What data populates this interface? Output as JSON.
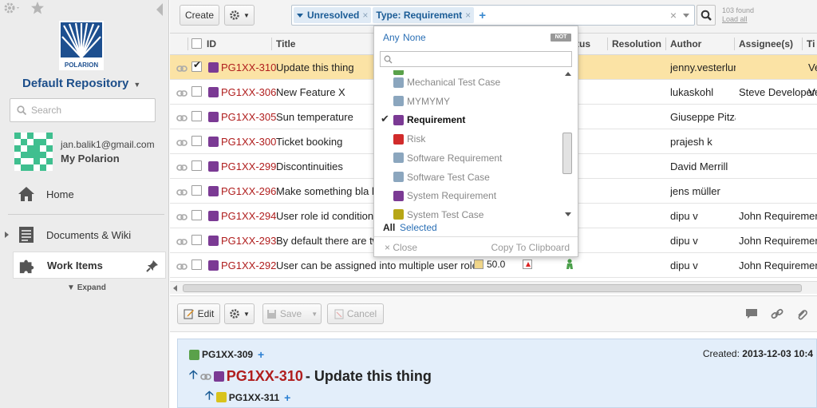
{
  "sidebar": {
    "logo_text": "POLARION",
    "repository": "Default Repository",
    "search_placeholder": "Search",
    "user_email": "jan.balik1@gmail.com",
    "my_polarion": "My Polarion",
    "nav": {
      "home": "Home",
      "docs": "Documents & Wiki",
      "work_items": "Work Items",
      "expand": "Expand"
    }
  },
  "toolbar": {
    "create": "Create",
    "query_chips": [
      "Unresolved",
      "Type: Requirement"
    ],
    "found": "103 found",
    "load_all": "Load all"
  },
  "table": {
    "columns": [
      "ID",
      "Title",
      "Status",
      "Resolution",
      "Author",
      "Assignee(s)",
      "Ti"
    ],
    "rows": [
      {
        "id": "PG1XX-310",
        "title": "Update this thing",
        "author": "jenny.vesterlund",
        "assignee": "",
        "extra": "Ve",
        "selected": true
      },
      {
        "id": "PG1XX-306",
        "title": "New Feature X",
        "author": "lukaskohl",
        "assignee": "Steve Developer",
        "extra": "Ve",
        "selected": false
      },
      {
        "id": "PG1XX-305",
        "title": "Sun temperature",
        "author": "Giuseppe Pitzalis",
        "assignee": "",
        "extra": "",
        "selected": false
      },
      {
        "id": "PG1XX-300",
        "title": "Ticket booking",
        "author": "prajesh k",
        "assignee": "",
        "extra": "",
        "selected": false
      },
      {
        "id": "PG1XX-299",
        "title": "Discontinuities",
        "author": "David Merrill",
        "assignee": "",
        "extra": "",
        "selected": false
      },
      {
        "id": "PG1XX-296",
        "title": "Make something bla bla",
        "author": "jens müller",
        "assignee": "",
        "extra": "",
        "selected": false
      },
      {
        "id": "PG1XX-294",
        "title": "User role id conditions",
        "author": "dipu v",
        "assignee": "John Requirements",
        "extra": "",
        "selected": false
      },
      {
        "id": "PG1XX-293",
        "title": "By default there are two",
        "author": "dipu v",
        "assignee": "John Requirements",
        "extra": "",
        "selected": false
      },
      {
        "id": "PG1XX-292",
        "title": "User can be assigned into multiple user roles",
        "author": "dipu v",
        "assignee": "John Requirements",
        "extra": "",
        "selected": false
      }
    ],
    "last_row_value": "50.0"
  },
  "popup": {
    "any": "Any",
    "none": "None",
    "not": "NOT",
    "items": [
      {
        "label": "Mechanical Test Case",
        "icon": "test-case-icon",
        "checked": false
      },
      {
        "label": "MYMYMY",
        "icon": "test-case-icon",
        "checked": false
      },
      {
        "label": "Requirement",
        "icon": "requirement-icon",
        "checked": true
      },
      {
        "label": "Risk",
        "icon": "risk-icon",
        "checked": false
      },
      {
        "label": "Software Requirement",
        "icon": "test-case-icon",
        "checked": false
      },
      {
        "label": "Software Test Case",
        "icon": "test-case-icon",
        "checked": false
      },
      {
        "label": "System Requirement",
        "icon": "requirement-icon",
        "checked": false
      },
      {
        "label": "System Test Case",
        "icon": "system-test-icon",
        "checked": false
      }
    ],
    "all": "All",
    "selected": "Selected",
    "close": "Close",
    "copy": "Copy To Clipboard"
  },
  "detail_toolbar": {
    "edit": "Edit",
    "save": "Save",
    "cancel": "Cancel"
  },
  "detail": {
    "parent_id": "PG1XX-309",
    "created_label": "Created:",
    "created_value": "2013-12-03 10:4",
    "item_id": "PG1XX-310",
    "item_title": " - Update this thing",
    "child_id": "PG1XX-311"
  },
  "colors": {
    "accent": "#1b5c96",
    "id_red": "#b01e1e",
    "selected_row": "#fbe3a5",
    "detail_bg": "#e3eefa"
  }
}
